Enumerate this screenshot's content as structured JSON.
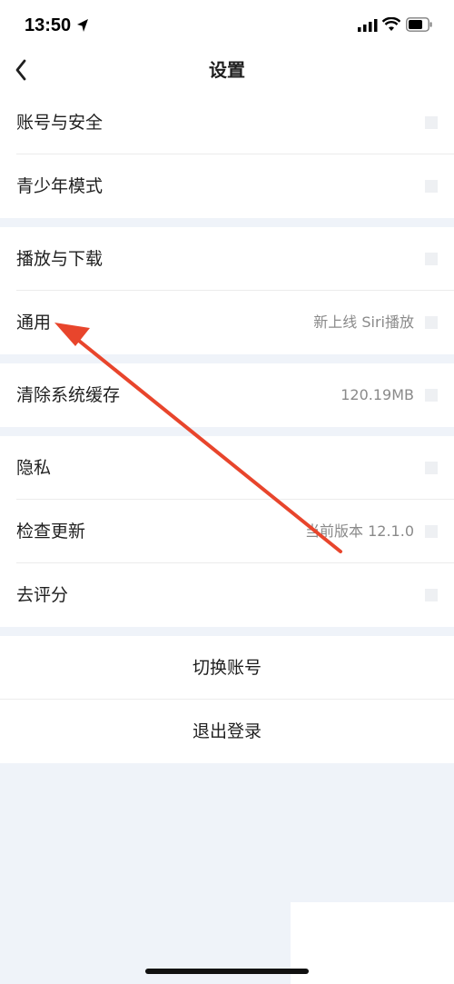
{
  "status_bar": {
    "time": "13:50"
  },
  "nav": {
    "title": "设置"
  },
  "groups": [
    {
      "rows": [
        {
          "label": "账号与安全",
          "value": ""
        },
        {
          "label": "青少年模式",
          "value": ""
        }
      ]
    },
    {
      "rows": [
        {
          "label": "播放与下载",
          "value": ""
        },
        {
          "label": "通用",
          "value": "新上线 Siri播放"
        }
      ]
    },
    {
      "rows": [
        {
          "label": "清除系统缓存",
          "value": "120.19MB"
        }
      ]
    },
    {
      "rows": [
        {
          "label": "隐私",
          "value": ""
        },
        {
          "label": "检查更新",
          "value": "当前版本 12.1.0"
        },
        {
          "label": "去评分",
          "value": ""
        }
      ]
    }
  ],
  "actions": {
    "switch_account": "切换账号",
    "logout": "退出登录"
  },
  "colors": {
    "background": "#eff3f9",
    "surface": "#ffffff",
    "annotation_arrow": "#e8452c"
  },
  "icons": {
    "location": "location-arrow-icon",
    "signal": "cellular-signal-icon",
    "wifi": "wifi-icon",
    "battery": "battery-icon",
    "back": "chevron-left-icon",
    "row_chevron": "chevron-right-icon"
  }
}
